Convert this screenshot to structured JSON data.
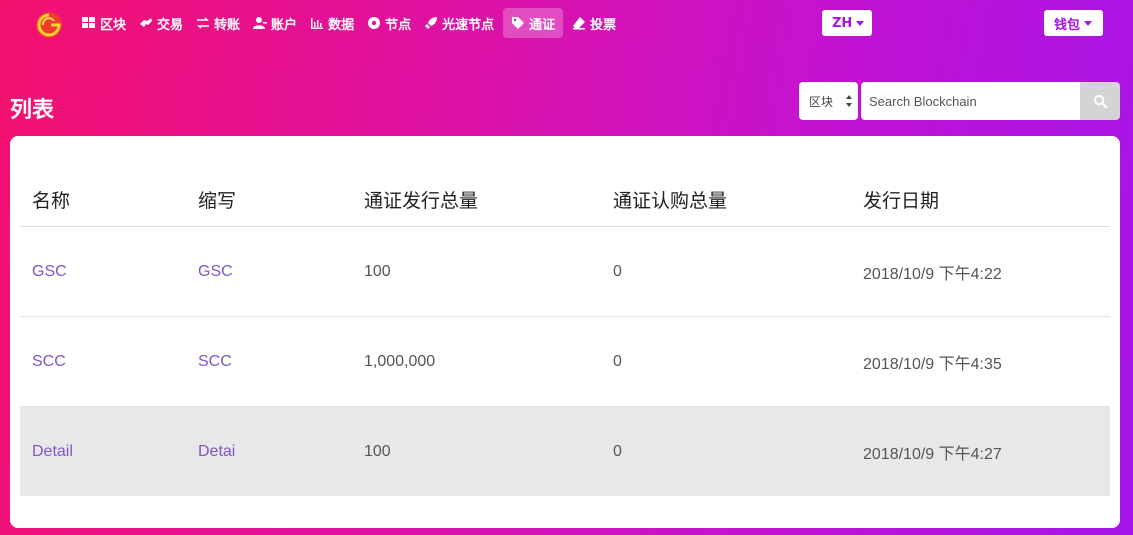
{
  "nav": {
    "items": [
      {
        "label": "区块",
        "icon": "grid-icon",
        "active": false
      },
      {
        "label": "交易",
        "icon": "handshake-icon",
        "active": false
      },
      {
        "label": "转账",
        "icon": "exchange-icon",
        "active": false
      },
      {
        "label": "账户",
        "icon": "user-icon",
        "active": false
      },
      {
        "label": "数据",
        "icon": "bar-chart-icon",
        "active": false
      },
      {
        "label": "节点",
        "icon": "node-circle-icon",
        "active": false
      },
      {
        "label": "光速节点",
        "icon": "rocket-icon",
        "active": false
      },
      {
        "label": "通证",
        "icon": "tag-icon",
        "active": true
      },
      {
        "label": "投票",
        "icon": "eraser-icon",
        "active": false
      }
    ]
  },
  "language": {
    "label": "ZH"
  },
  "wallet": {
    "label": "钱包"
  },
  "page": {
    "title": "列表"
  },
  "search": {
    "type_selected": "区块",
    "placeholder": "Search Blockchain",
    "value": ""
  },
  "table": {
    "headers": [
      "名称",
      "缩写",
      "通证发行总量",
      "通证认购总量",
      "发行日期"
    ],
    "rows": [
      {
        "name": "GSC",
        "abbr": "GSC",
        "total_issued": "100",
        "total_subscribed": "0",
        "issue_date": "2018/10/9 下午4:22"
      },
      {
        "name": "SCC",
        "abbr": "SCC",
        "total_issued": "1,000,000",
        "total_subscribed": "0",
        "issue_date": "2018/10/9 下午4:35"
      },
      {
        "name": "Detail",
        "abbr": "Detai",
        "total_issued": "100",
        "total_subscribed": "0",
        "issue_date": "2018/10/9 下午4:27"
      }
    ]
  },
  "colors": {
    "gradient_start": "#f4116e",
    "gradient_end": "#a414e8",
    "link": "#8256c2",
    "highlight_row": "#e8e8e8"
  }
}
